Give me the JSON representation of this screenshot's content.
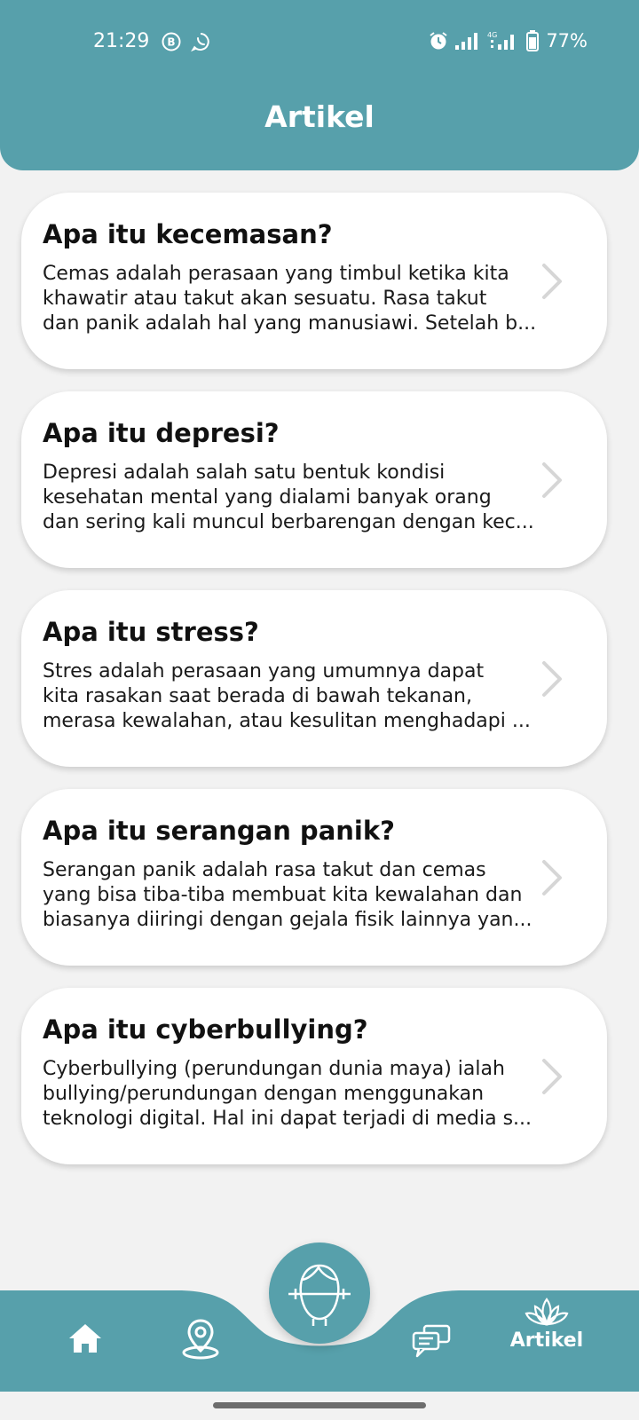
{
  "status_bar": {
    "time": "21:29",
    "battery": "77%",
    "notifications": [
      "b-notification-icon",
      "whatsapp-icon"
    ],
    "indicators": [
      "alarm-icon",
      "signal-icon",
      "4g-signal-icon",
      "battery-icon"
    ]
  },
  "header": {
    "title": "Artikel"
  },
  "articles": [
    {
      "title": "Apa itu kecemasan?",
      "lines": [
        "Cemas adalah perasaan yang timbul ketika kita",
        "khawatir atau takut akan sesuatu. Rasa takut",
        "dan panik adalah hal yang manusiawi. Setelah b..."
      ]
    },
    {
      "title": "Apa itu depresi?",
      "lines": [
        "Depresi adalah salah satu bentuk kondisi",
        "kesehatan mental yang dialami banyak orang",
        "dan sering kali muncul berbarengan dengan kec..."
      ]
    },
    {
      "title": "Apa itu stress?",
      "lines": [
        "Stres adalah perasaan yang umumnya dapat",
        "kita rasakan saat berada di bawah tekanan,",
        "merasa kewalahan, atau kesulitan menghadapi ..."
      ]
    },
    {
      "title": "Apa itu serangan panik?",
      "lines": [
        "Serangan panik adalah rasa takut dan cemas",
        "yang bisa tiba-tiba membuat kita kewalahan dan",
        "biasanya diiringi dengan gejala fisik lainnya yan..."
      ]
    },
    {
      "title": "Apa itu cyberbullying?",
      "lines": [
        "Cyberbullying (perundungan dunia maya) ialah",
        "bullying/perundungan dengan menggunakan",
        "teknologi digital. Hal ini dapat terjadi di media s..."
      ]
    }
  ],
  "bottom_nav": {
    "items": [
      {
        "icon": "home-icon",
        "label": ""
      },
      {
        "icon": "location-pin-icon",
        "label": ""
      },
      {
        "icon": "face-scan-icon",
        "label": ""
      },
      {
        "icon": "chat-icon",
        "label": ""
      },
      {
        "icon": "lotus-icon",
        "label": "Artikel"
      }
    ]
  },
  "colors": {
    "primary": "#57a0ab",
    "background": "#f2f2f2",
    "card": "#ffffff",
    "chevron": "#d6d6d6"
  }
}
